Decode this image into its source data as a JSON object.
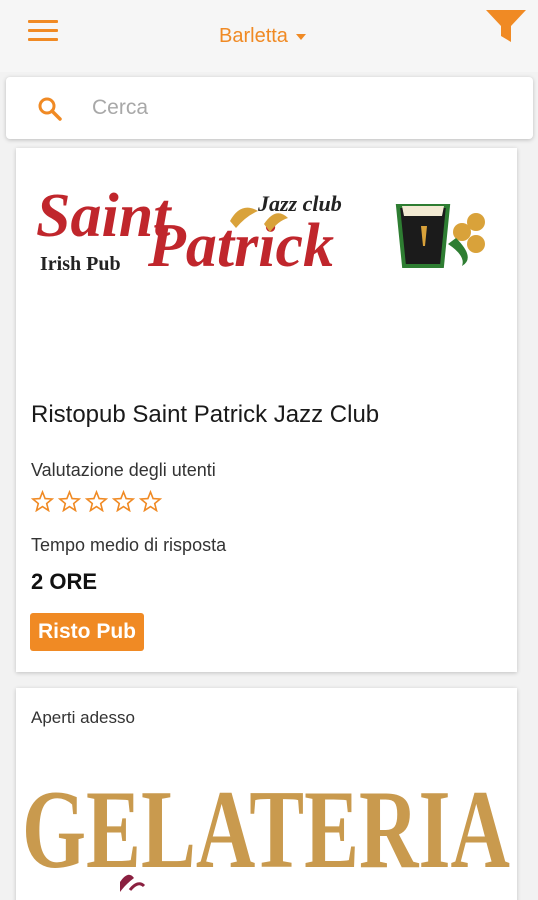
{
  "header": {
    "city": "Barletta",
    "menu_icon": "hamburger-menu-icon",
    "filter_icon": "funnel-filter-icon",
    "accent_color": "#f08a24"
  },
  "search": {
    "placeholder": "Cerca",
    "icon": "search-icon"
  },
  "listings": [
    {
      "logo_text": {
        "main1": "Saint",
        "main2": "Patrick",
        "tag": "Jazz club",
        "sub": "Irish Pub"
      },
      "title": "Ristopub Saint Patrick Jazz Club",
      "rating_label": "Valutazione degli utenti",
      "rating": 0,
      "rating_max": 5,
      "response_label": "Tempo medio di risposta",
      "response_value": "2 ORE",
      "category": "Risto Pub"
    },
    {
      "status": "Aperti adesso",
      "logo_text": "GELATERIA"
    }
  ]
}
